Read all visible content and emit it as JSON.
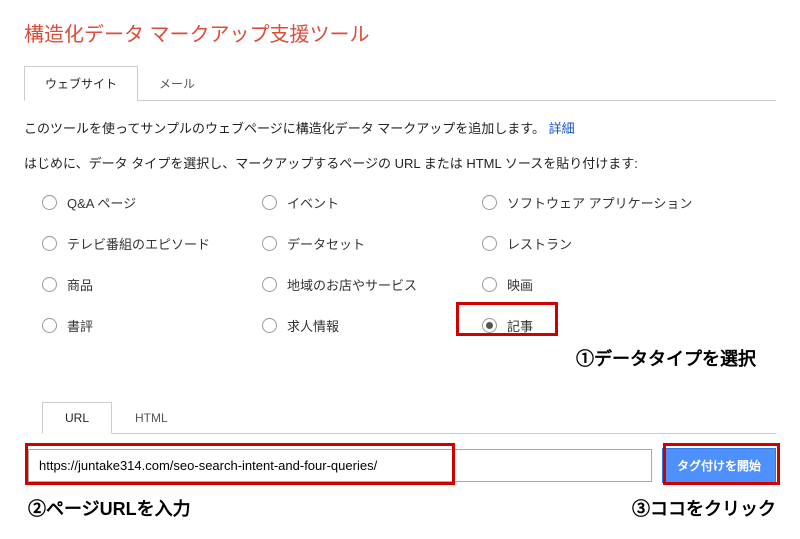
{
  "title": "構造化データ マークアップ支援ツール",
  "mainTabs": {
    "website": "ウェブサイト",
    "mail": "メール"
  },
  "descriptionPre": "このツールを使ってサンプルのウェブページに構造化データ マークアップを追加します。",
  "detailLink": "詳細",
  "instruction": "はじめに、データ タイプを選択し、マークアップするページの URL または HTML ソースを貼り付けます:",
  "dataTypes": {
    "qa": "Q&A ページ",
    "event": "イベント",
    "software": "ソフトウェア アプリケーション",
    "tv": "テレビ番組のエピソード",
    "dataset": "データセット",
    "restaurant": "レストラン",
    "product": "商品",
    "local": "地域のお店やサービス",
    "movie": "映画",
    "review": "書評",
    "job": "求人情報",
    "article": "記事"
  },
  "sourceTabs": {
    "url": "URL",
    "html": "HTML"
  },
  "urlInput": {
    "value": "https://juntake314.com/seo-search-intent-and-four-queries/"
  },
  "startButton": "タグ付けを開始",
  "annotations": {
    "step1": "①データタイプを選択",
    "step2": "②ページURLを入力",
    "step3": "③ココをクリック"
  }
}
